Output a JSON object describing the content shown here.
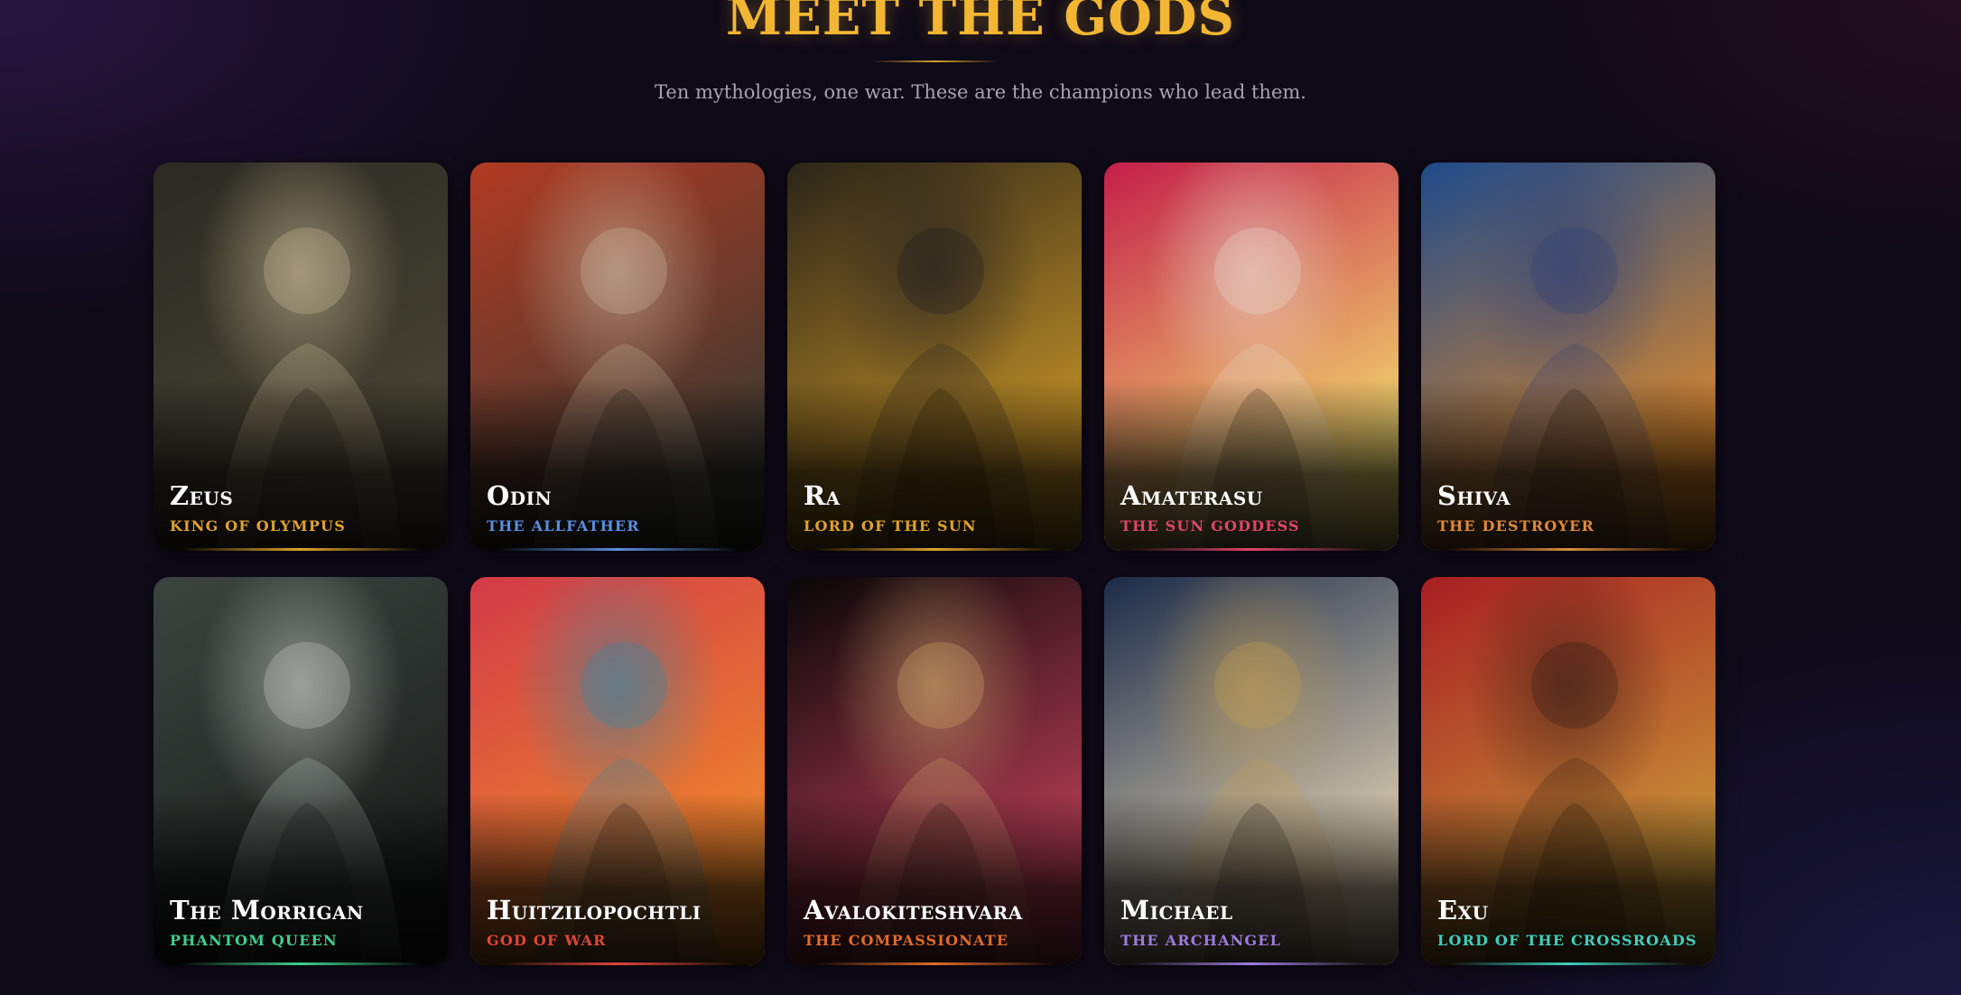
{
  "header": {
    "title": "MEET THE GODS",
    "subtitle": "Ten mythologies, one war. These are the champions who lead them."
  },
  "gods": [
    {
      "name": "Zeus",
      "role": "King of Olympus",
      "accent": "#e0a22c",
      "art_colors": [
        "#2a2a22",
        "#4a4636",
        "#d9c7a0"
      ]
    },
    {
      "name": "Odin",
      "role": "The Allfather",
      "accent": "#5b8de0",
      "art_colors": [
        "#b23a22",
        "#3a3a32",
        "#cfc2a8"
      ]
    },
    {
      "name": "Ra",
      "role": "Lord of the Sun",
      "accent": "#e0a22c",
      "art_colors": [
        "#2a2418",
        "#c99628",
        "#1a1a22"
      ]
    },
    {
      "name": "Amaterasu",
      "role": "The Sun Goddess",
      "accent": "#e0456a",
      "art_colors": [
        "#c41e4a",
        "#f4e070",
        "#e8e0d8"
      ]
    },
    {
      "name": "Shiva",
      "role": "The Destroyer",
      "accent": "#e08a3a",
      "art_colors": [
        "#1e4a8a",
        "#e08a2a",
        "#2a3c78"
      ]
    },
    {
      "name": "The Morrigan",
      "role": "Phantom Queen",
      "accent": "#3fcf8e",
      "art_colors": [
        "#3c4440",
        "#1a1e1c",
        "#cfd4d0"
      ]
    },
    {
      "name": "Huitzilopochtli",
      "role": "God of War",
      "accent": "#e0453a",
      "art_colors": [
        "#d23a48",
        "#f08a2a",
        "#2a8aa8"
      ]
    },
    {
      "name": "Avalokiteshvara",
      "role": "The Compassionate",
      "accent": "#e06a2a",
      "art_colors": [
        "#060606",
        "#c0405a",
        "#d8b070"
      ]
    },
    {
      "name": "Michael",
      "role": "The Archangel",
      "accent": "#9b7be0",
      "art_colors": [
        "#1a2a48",
        "#e8d8b8",
        "#c8a050"
      ]
    },
    {
      "name": "Exu",
      "role": "Lord of the Crossroads",
      "accent": "#3fcfbe",
      "art_colors": [
        "#a81e22",
        "#c99a38",
        "#2a1a14"
      ]
    }
  ]
}
